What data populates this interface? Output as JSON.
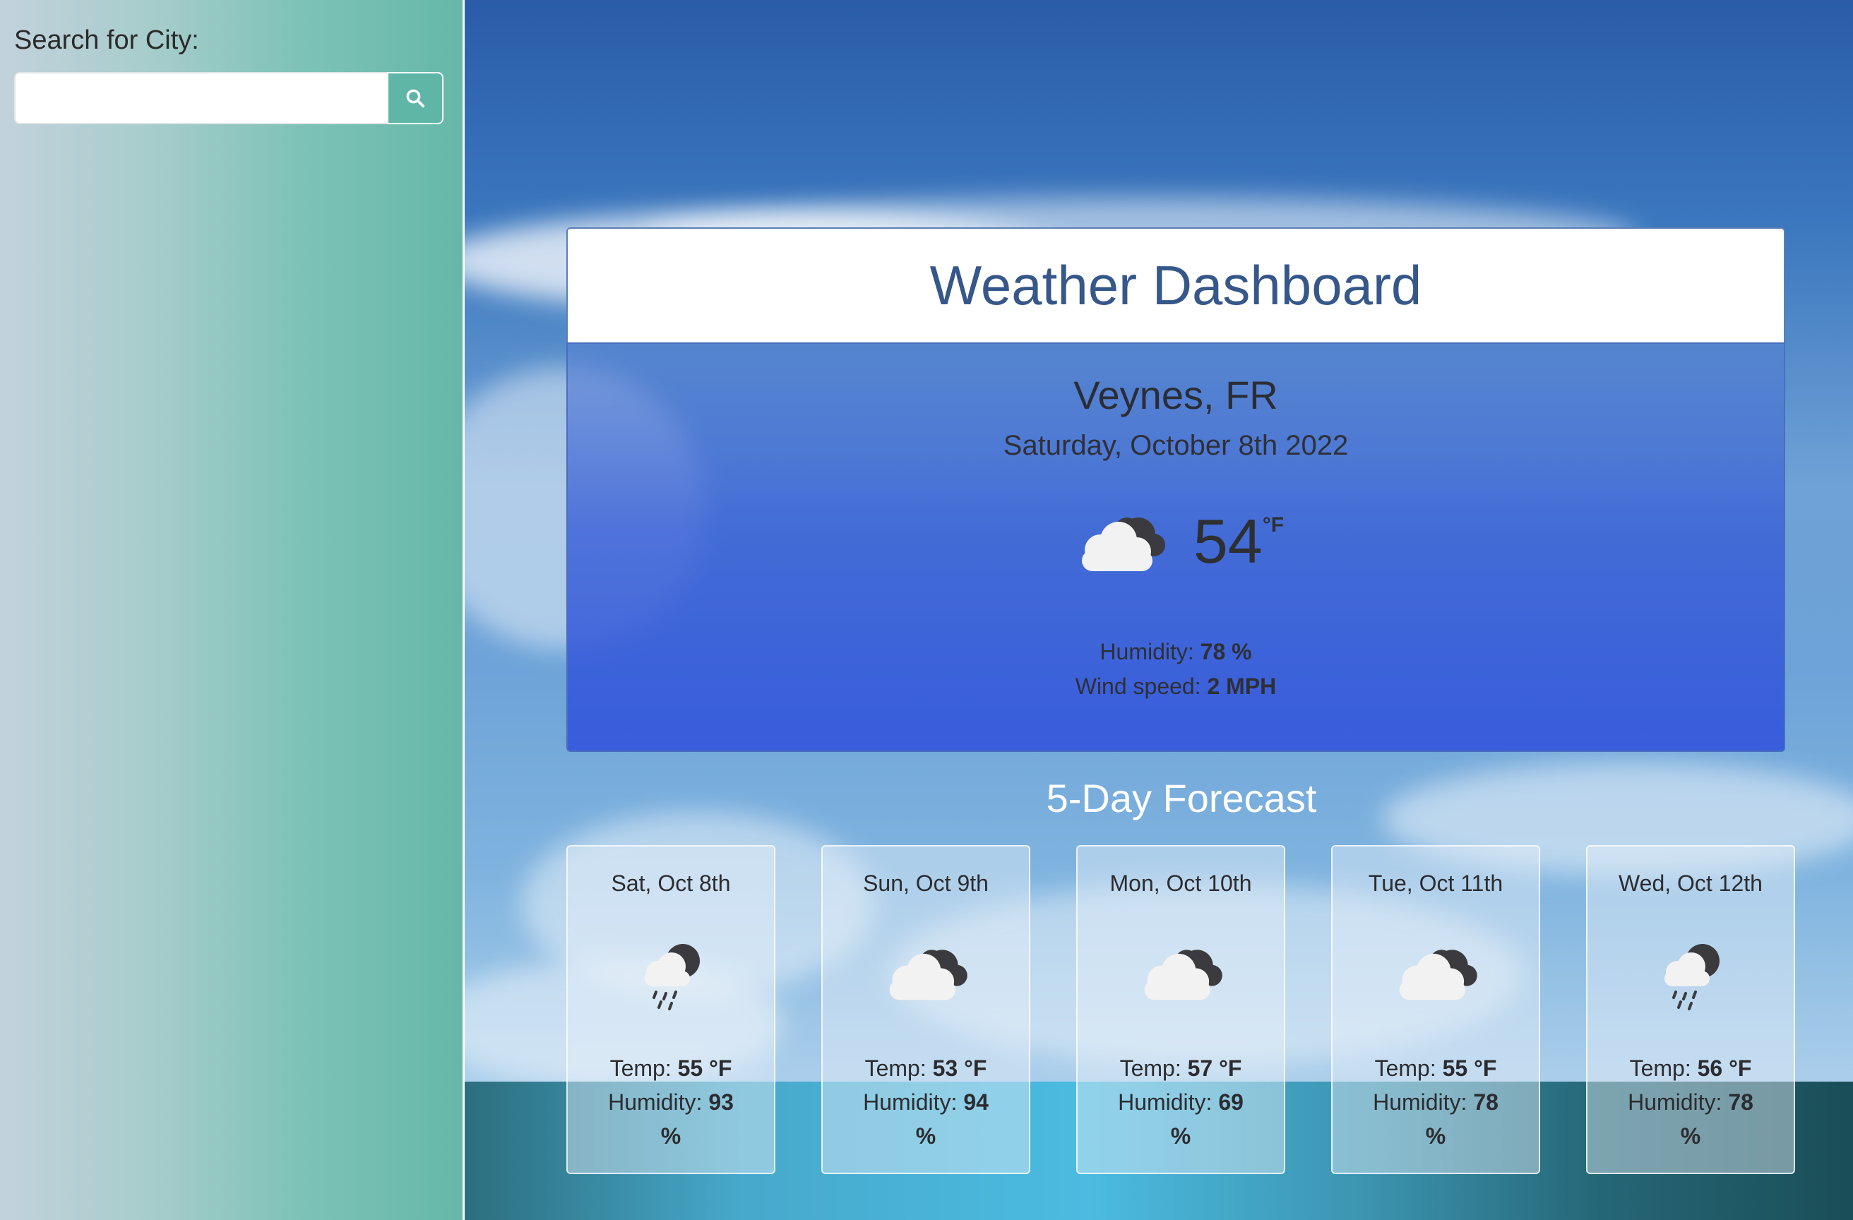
{
  "sidebar": {
    "search_label": "Search for City:",
    "search_value": "",
    "search_icon": "search-icon"
  },
  "header": {
    "title": "Weather Dashboard"
  },
  "current": {
    "city": "Veynes, FR",
    "date": "Saturday, October 8th 2022",
    "icon": "cloudy-icon",
    "temp": "54",
    "temp_unit": "°F",
    "humidity_label": "Humidity: ",
    "humidity_value": "78 %",
    "wind_label": "Wind speed: ",
    "wind_value": "2 MPH"
  },
  "forecast": {
    "title": "5-Day Forecast",
    "temp_label": "Temp: ",
    "humidity_label": "Humidity: ",
    "days": [
      {
        "date": "Sat, Oct 8th",
        "icon": "rain-cloud-icon",
        "temp": "55 °F",
        "humidity": "93",
        "unit": "%"
      },
      {
        "date": "Sun, Oct 9th",
        "icon": "cloudy-icon",
        "temp": "53 °F",
        "humidity": "94",
        "unit": "%"
      },
      {
        "date": "Mon, Oct 10th",
        "icon": "cloudy-icon",
        "temp": "57 °F",
        "humidity": "69",
        "unit": "%"
      },
      {
        "date": "Tue, Oct 11th",
        "icon": "cloudy-icon",
        "temp": "55 °F",
        "humidity": "78",
        "unit": "%"
      },
      {
        "date": "Wed, Oct 12th",
        "icon": "rain-cloud-icon",
        "temp": "56 °F",
        "humidity": "78",
        "unit": "%"
      }
    ]
  },
  "colors": {
    "title": "#36578a",
    "sidebar_accent": "#5fb6a7",
    "card_blue": "#3a5fd6"
  }
}
